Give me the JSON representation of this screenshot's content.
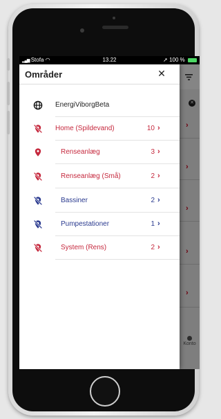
{
  "status_bar": {
    "carrier": "Stofa",
    "time": "13.22",
    "battery": "100 %"
  },
  "drawer": {
    "title": "Områder",
    "close_label": "✕",
    "root_item": {
      "label": "EnergiViborgBeta"
    },
    "items": [
      {
        "label": "Home (Spildevand)",
        "count": "10",
        "color": "#c5283d",
        "icon": "location-off-icon"
      },
      {
        "label": "Renseanlæg",
        "count": "3",
        "color": "#c5283d",
        "icon": "location-pin-icon"
      },
      {
        "label": "Renseanlæg (Små)",
        "count": "2",
        "color": "#c5283d",
        "icon": "location-off-icon"
      },
      {
        "label": "Bassiner",
        "count": "2",
        "color": "#2a3a8f",
        "icon": "location-off-icon"
      },
      {
        "label": "Pumpestationer",
        "count": "1",
        "color": "#2a3a8f",
        "icon": "location-off-icon"
      },
      {
        "label": "System (Rens)",
        "count": "2",
        "color": "#c5283d",
        "icon": "location-off-icon"
      }
    ]
  },
  "background_app": {
    "tab_label": "Konto"
  }
}
